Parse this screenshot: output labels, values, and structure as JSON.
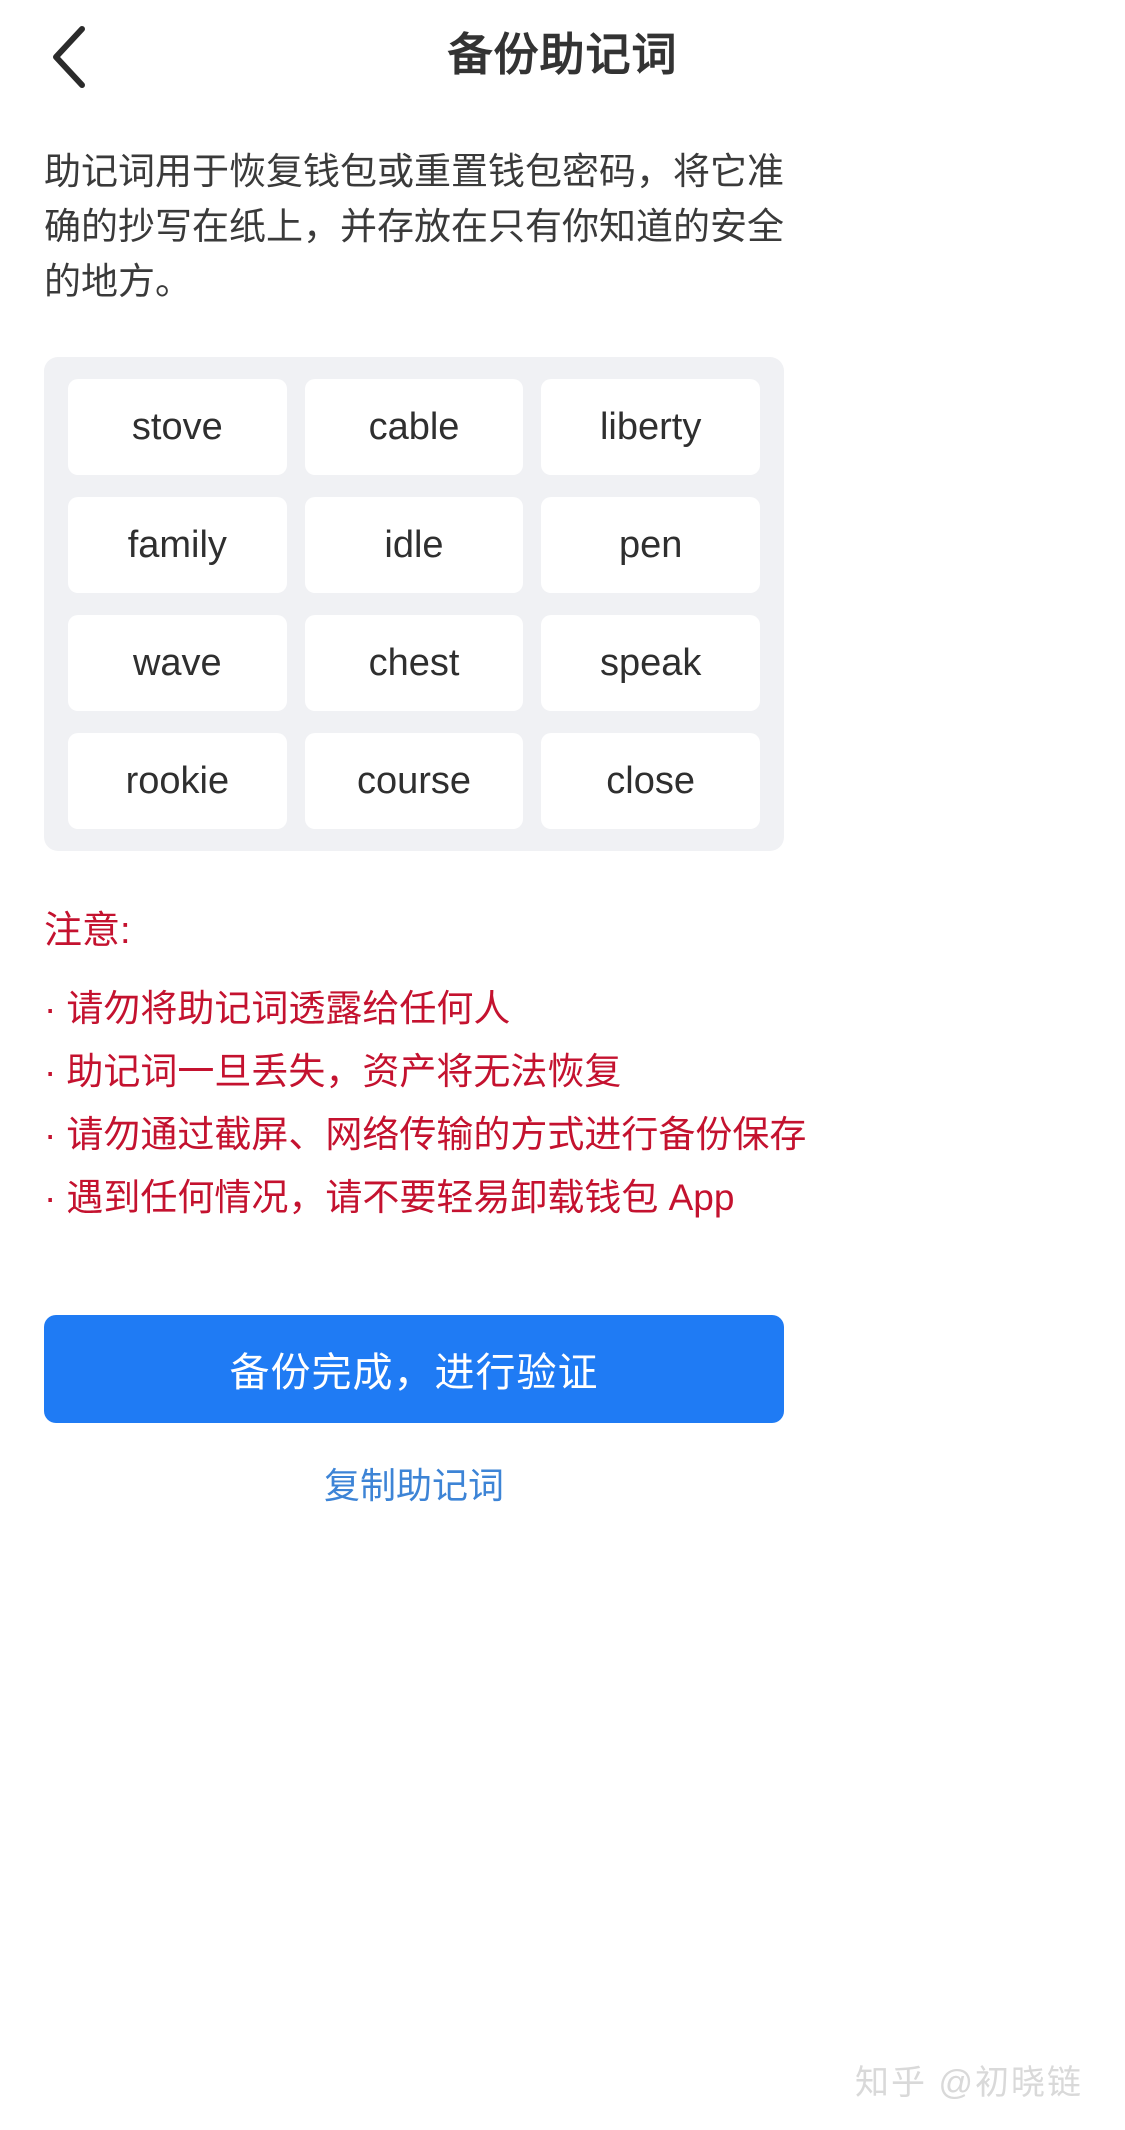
{
  "header": {
    "back_icon": "chevron-left-icon",
    "title": "备份助记词"
  },
  "description": "助记词用于恢复钱包或重置钱包密码，将它准确的抄写在纸上，并存放在只有你知道的安全的地方。",
  "mnemonic": {
    "words": [
      "stove",
      "cable",
      "liberty",
      "family",
      "idle",
      "pen",
      "wave",
      "chest",
      "speak",
      "rookie",
      "course",
      "close"
    ]
  },
  "warning": {
    "title": "注意:",
    "bullet": "·",
    "items": [
      "请勿将助记词透露给任何人",
      "助记词一旦丢失，资产将无法恢复",
      "请勿通过截屏、网络传输的方式进行备份保存",
      "遇到任何情况，请不要轻易卸载钱包 App"
    ],
    "color": "#c4122f"
  },
  "actions": {
    "primary_label": "备份完成，进行验证",
    "primary_color": "#1f7bf4",
    "secondary_label": "复制助记词",
    "secondary_color": "#3d84d6"
  },
  "watermark": "知乎 @初晓链"
}
